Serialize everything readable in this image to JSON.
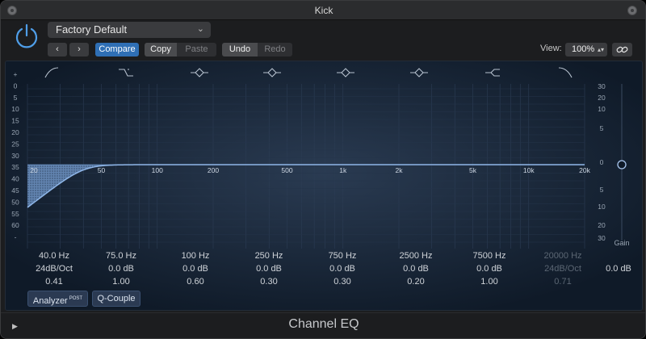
{
  "window": {
    "title": "Kick"
  },
  "header": {
    "preset": "Factory Default",
    "prev_label": "‹",
    "next_label": "›",
    "compare": "Compare",
    "copy": "Copy",
    "paste": "Paste",
    "undo": "Undo",
    "redo": "Redo",
    "view_label": "View:",
    "view_value": "100%"
  },
  "left_scale": [
    "+",
    "0",
    "5",
    "10",
    "15",
    "20",
    "25",
    "30",
    "35",
    "40",
    "45",
    "50",
    "55",
    "60",
    "-"
  ],
  "right_scale": [
    "30",
    "20",
    "10",
    "5",
    "0",
    "5",
    "10",
    "20",
    "30"
  ],
  "freq_labels": [
    "20",
    "50",
    "100",
    "200",
    "500",
    "1k",
    "2k",
    "5k",
    "10k",
    "20k"
  ],
  "band_icons": [
    "low-cut-icon",
    "low-shelf-icon",
    "parametric-icon",
    "parametric-icon",
    "parametric-icon",
    "parametric-icon",
    "high-shelf-icon",
    "high-cut-icon"
  ],
  "bands": [
    {
      "freq": "40.0 Hz",
      "gain": "24dB/Oct",
      "q": "0.41",
      "enabled": true
    },
    {
      "freq": "75.0 Hz",
      "gain": "0.0 dB",
      "q": "1.00",
      "enabled": true
    },
    {
      "freq": "100 Hz",
      "gain": "0.0 dB",
      "q": "0.60",
      "enabled": true
    },
    {
      "freq": "250 Hz",
      "gain": "0.0 dB",
      "q": "0.30",
      "enabled": true
    },
    {
      "freq": "750 Hz",
      "gain": "0.0 dB",
      "q": "0.30",
      "enabled": true
    },
    {
      "freq": "2500 Hz",
      "gain": "0.0 dB",
      "q": "0.20",
      "enabled": true
    },
    {
      "freq": "7500 Hz",
      "gain": "0.0 dB",
      "q": "1.00",
      "enabled": true
    },
    {
      "freq": "20000 Hz",
      "gain": "24dB/Oct",
      "q": "0.71",
      "enabled": false
    }
  ],
  "gain": {
    "label": "Gain",
    "value": "0.0 dB"
  },
  "buttons": {
    "analyzer": "Analyzer",
    "analyzer_badge": "POST",
    "q_couple": "Q-Couple"
  },
  "footer": {
    "plugin_name": "Channel EQ"
  },
  "colors": {
    "accent": "#2f6fb5",
    "curve": "#8fb6e8",
    "panel": "#0f1a28"
  }
}
